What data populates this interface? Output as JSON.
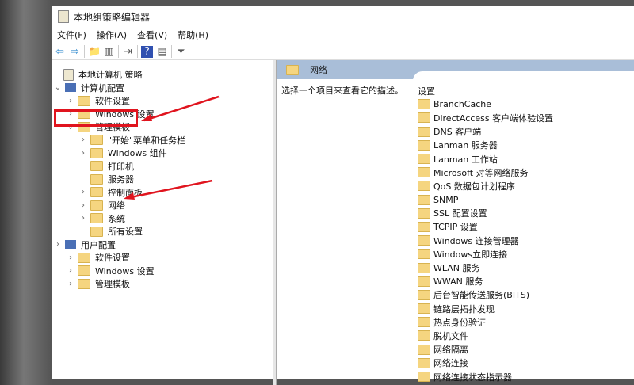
{
  "window": {
    "title": "本地组策略编辑器"
  },
  "menu": [
    "文件(F)",
    "操作(A)",
    "查看(V)",
    "帮助(H)"
  ],
  "toolbar": {
    "icons": [
      "back-icon",
      "forward-icon",
      "up-folder-icon",
      "show-hide-tree-icon",
      "export-icon",
      "help-icon",
      "properties-icon",
      "filter-icon"
    ],
    "glyphs": [
      "⇦",
      "⇨",
      "📁",
      "▥",
      "⇥",
      "?",
      "▤",
      "⏷"
    ]
  },
  "tree": [
    {
      "label": "本地计算机 策略",
      "level": 0,
      "chev": "",
      "icon": "doc"
    },
    {
      "label": "计算机配置",
      "level": 0,
      "chev": "⌄",
      "icon": "pc"
    },
    {
      "label": "软件设置",
      "level": 1,
      "chev": "›",
      "icon": "folder"
    },
    {
      "label": "Windows 设置",
      "level": 1,
      "chev": "›",
      "icon": "folder"
    },
    {
      "label": "管理模板",
      "level": 1,
      "chev": "⌄",
      "icon": "folder"
    },
    {
      "label": "\"开始\"菜单和任务栏",
      "level": 2,
      "chev": "›",
      "icon": "folder"
    },
    {
      "label": "Windows 组件",
      "level": 2,
      "chev": "›",
      "icon": "folder"
    },
    {
      "label": "打印机",
      "level": 2,
      "chev": "",
      "icon": "folder"
    },
    {
      "label": "服务器",
      "level": 2,
      "chev": "",
      "icon": "folder"
    },
    {
      "label": "控制面板",
      "level": 2,
      "chev": "›",
      "icon": "folder"
    },
    {
      "label": "网络",
      "level": 2,
      "chev": "›",
      "icon": "folder"
    },
    {
      "label": "系统",
      "level": 2,
      "chev": "›",
      "icon": "folder"
    },
    {
      "label": "所有设置",
      "level": 2,
      "chev": "",
      "icon": "folder"
    },
    {
      "label": "用户配置",
      "level": 0,
      "chev": "›",
      "icon": "pc"
    },
    {
      "label": "软件设置",
      "level": 1,
      "chev": "›",
      "icon": "folder"
    },
    {
      "label": "Windows 设置",
      "level": 1,
      "chev": "›",
      "icon": "folder"
    },
    {
      "label": "管理模板",
      "level": 1,
      "chev": "›",
      "icon": "folder"
    }
  ],
  "right": {
    "header": "网络",
    "description": "选择一个项目来查看它的描述。",
    "column": "设置",
    "items": [
      "BranchCache",
      "DirectAccess 客户端体验设置",
      "DNS 客户端",
      "Lanman 服务器",
      "Lanman 工作站",
      "Microsoft 对等网络服务",
      "QoS 数据包计划程序",
      "SNMP",
      "SSL 配置设置",
      "TCPIP 设置",
      "Windows 连接管理器",
      "Windows立即连接",
      "WLAN 服务",
      "WWAN 服务",
      "后台智能传送服务(BITS)",
      "链路层拓扑发现",
      "热点身份验证",
      "脱机文件",
      "网络隔离",
      "网络连接",
      "网络连接状态指示器"
    ]
  },
  "annotation_color": "#e0141e"
}
